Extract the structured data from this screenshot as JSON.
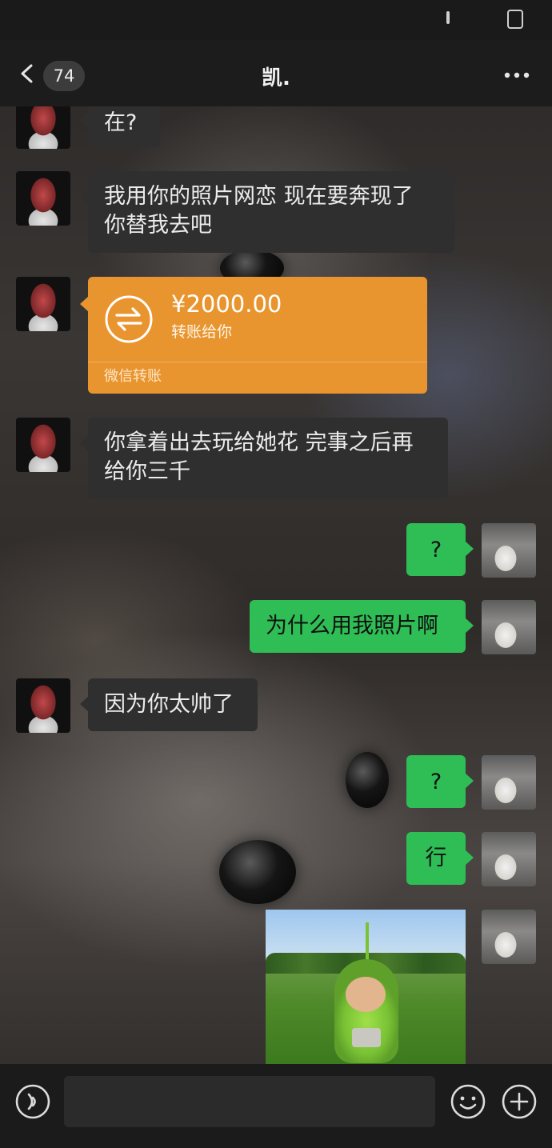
{
  "nav": {
    "back_count": "74",
    "title": "凯."
  },
  "messages": {
    "m1": "在?",
    "m2_line1": "我用你的照片网恋 现在要奔现了",
    "m2_line2": "你替我去吧",
    "m4_line1": "你拿着出去玩给她花 完事之后再",
    "m4_line2": "给你三千",
    "m5": "?",
    "m6": "为什么用我照片啊",
    "m7": "因为你太帅了",
    "m8": "?",
    "m9": "行"
  },
  "transfer": {
    "amount": "¥2000.00",
    "note": "转账给你",
    "footer": "微信转账",
    "color": "#e9952f"
  },
  "bottom": {
    "input_value": ""
  },
  "icons": {
    "back": "chevron-left-icon",
    "more": "more-dots-icon",
    "voice": "voice-icon",
    "emoji": "emoji-icon",
    "plus": "plus-icon",
    "transfer": "transfer-arrows-icon"
  },
  "colors": {
    "outgoing_bubble": "#2fbd55",
    "incoming_bubble": "#2f2f2f"
  }
}
